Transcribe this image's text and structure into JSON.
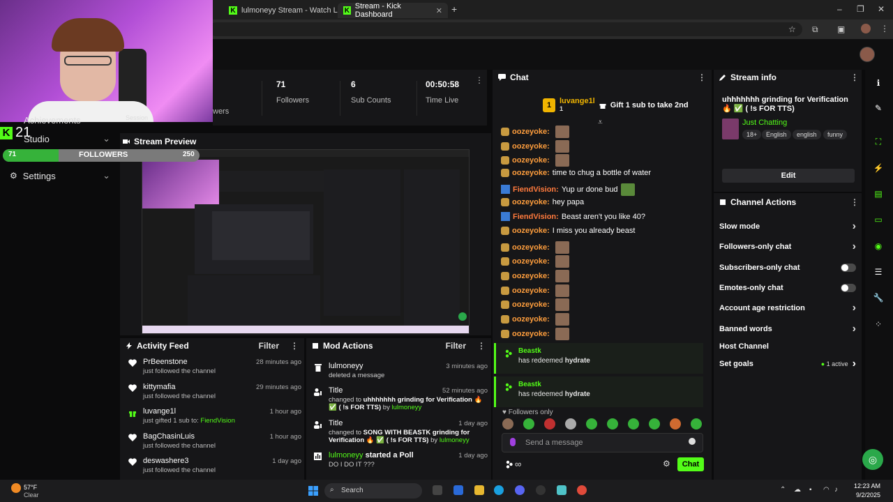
{
  "browser": {
    "tabs": [
      {
        "label": "lulmoneyy Stream - Watch Live",
        "active": false
      },
      {
        "label": "Stream - Kick Dashboard",
        "active": true
      }
    ],
    "new_tab": "+",
    "window_controls": {
      "minimize": "–",
      "maximize": "❐",
      "close": "✕"
    }
  },
  "overlay": {
    "achievements": "Achievements",
    "kick_count": "21",
    "studio": "Studio",
    "followers_label": "FOLLOWERS",
    "followers_current": "71",
    "followers_goal": "250",
    "followers_progress": 0.284,
    "settings": "Settings",
    "session_partial": "Session",
    "followers_partial": "wers"
  },
  "stats": [
    {
      "value": "71",
      "label": "Followers"
    },
    {
      "value": "6",
      "label": "Sub Counts"
    },
    {
      "value": "00:50:58",
      "label": "Time Live"
    }
  ],
  "preview": {
    "title": "Stream Preview"
  },
  "activity": {
    "title": "Activity Feed",
    "filter": "Filter",
    "items": [
      {
        "name": "PrBeenstone",
        "desc": "just followed the channel",
        "time": "28 minutes ago",
        "icon": "heart-icon"
      },
      {
        "name": "kittymafia",
        "desc": "just followed the channel",
        "time": "29 minutes ago",
        "icon": "heart-icon"
      },
      {
        "name": "luvange1l",
        "desc_prefix": "just gifted 1 sub to:",
        "desc_target": "FiendVision",
        "time": "1 hour ago",
        "icon": "gift-icon"
      },
      {
        "name": "BagChasinLuis",
        "desc": "just followed the channel",
        "time": "1 hour ago",
        "icon": "heart-icon"
      },
      {
        "name": "deswashere3",
        "desc": "just followed the channel",
        "time": "1 day ago",
        "icon": "heart-icon"
      }
    ]
  },
  "mod": {
    "title": "Mod Actions",
    "filter": "Filter",
    "items": [
      {
        "name": "lulmoneyy",
        "desc": "deleted a message",
        "time": "3 minutes ago"
      },
      {
        "name": "Title",
        "desc_prefix": "changed to",
        "desc_value": "uhhhhhhh grinding for Verification 🔥 ✅ ( !s FOR TTS)",
        "desc_by": "by",
        "desc_user": "lulmoneyy",
        "time": "52 minutes ago"
      },
      {
        "name": "Title",
        "desc_prefix": "changed to",
        "desc_value": "SONG WITH BEASTK grinding for Verification 🔥 ✅ ( !s FOR TTS)",
        "desc_by": "by",
        "desc_user": "lulmoneyy",
        "time": "1 day ago"
      },
      {
        "name": "lulmoneyy",
        "name_suffix": "started a Poll",
        "desc": "DO I DO IT ???",
        "time": "1 day ago"
      }
    ]
  },
  "chat": {
    "title": "Chat",
    "pinned": {
      "user": "luvange1l",
      "count": "1",
      "text": "Gift 1 sub to take 2nd"
    },
    "lines": [
      {
        "user": "oozeyoke:",
        "text": "",
        "badge": "bag",
        "emote": true
      },
      {
        "user": "oozeyoke:",
        "text": "",
        "badge": "bag",
        "emote": true
      },
      {
        "user": "oozeyoke:",
        "text": "",
        "badge": "bag",
        "emote": true
      },
      {
        "user": "oozeyoke:",
        "text": "time to chug a bottle of water",
        "badge": "bag",
        "emote": false
      },
      {
        "user": "FiendVision:",
        "text": "Yup ur done bud",
        "badge": "blue",
        "emote": true
      },
      {
        "user": "oozeyoke:",
        "text": "hey papa",
        "badge": "bag",
        "emote": false
      },
      {
        "user": "FiendVision:",
        "text": "Beast aren't you like 40?",
        "badge": "blue",
        "emote": false
      },
      {
        "user": "oozeyoke:",
        "text": "I miss you already beast",
        "badge": "bag",
        "emote": false
      },
      {
        "user": "oozeyoke:",
        "text": "",
        "badge": "bag",
        "emote": true
      },
      {
        "user": "oozeyoke:",
        "text": "",
        "badge": "bag",
        "emote": true
      },
      {
        "user": "oozeyoke:",
        "text": "",
        "badge": "bag",
        "emote": true
      },
      {
        "user": "oozeyoke:",
        "text": "",
        "badge": "bag",
        "emote": true
      },
      {
        "user": "oozeyoke:",
        "text": "",
        "badge": "bag",
        "emote": true
      },
      {
        "user": "oozeyoke:",
        "text": "",
        "badge": "bag",
        "emote": true
      },
      {
        "user": "oozeyoke:",
        "text": "",
        "badge": "bag",
        "emote": true
      }
    ],
    "redeems": [
      {
        "user": "Beastk",
        "prefix": "has redeemed",
        "reward": "hydrate"
      },
      {
        "user": "Beastk",
        "prefix": "has redeemed",
        "reward": "hydrate"
      }
    ],
    "followers_only": "Followers only",
    "placeholder": "Send a message",
    "chat_button": "Chat"
  },
  "stream_info": {
    "title": "Stream info",
    "stream_title": "uhhhhhhh grinding for Verification 🔥 ✅ ( !s FOR TTS)",
    "category": "Just Chatting",
    "tags": [
      "18+",
      "English",
      "english",
      "funny"
    ],
    "edit": "Edit"
  },
  "channel_actions": {
    "title": "Channel Actions",
    "rows": [
      {
        "label": "Slow mode",
        "control": "chevron"
      },
      {
        "label": "Followers-only chat",
        "control": "chevron"
      },
      {
        "label": "Subscribers-only chat",
        "control": "toggle"
      },
      {
        "label": "Emotes-only chat",
        "control": "toggle"
      },
      {
        "label": "Account age restriction",
        "control": "chevron"
      },
      {
        "label": "Banned words",
        "control": "chevron"
      },
      {
        "label": "Host Channel",
        "control": "none"
      },
      {
        "label": "Set goals",
        "control": "active",
        "active_text": "1 active"
      }
    ]
  },
  "taskbar": {
    "temp": "57°F",
    "condition": "Clear",
    "search": "Search",
    "time": "12:23 AM",
    "date": "9/2/2025"
  },
  "colors": {
    "kick_green": "#53fc18",
    "bg": "#0b0b0c",
    "panel": "#161618"
  }
}
